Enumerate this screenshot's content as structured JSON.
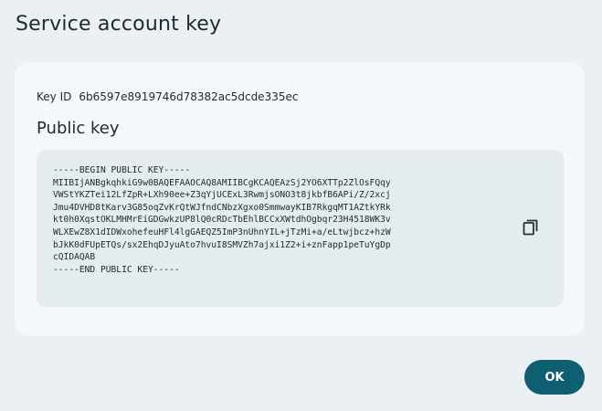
{
  "dialog": {
    "title": "Service account key",
    "ok_label": "OK"
  },
  "key": {
    "id_label": "Key ID",
    "id_value": "6b6597e8919746d78382ac5dcde335ec",
    "section_title": "Public key",
    "public_key_text": "-----BEGIN PUBLIC KEY-----\nMIIBIjANBgkqhkiG9w0BAQEFAAOCAQ8AMIIBCgKCAQEAzSj2YO6XTTp2ZlOsFQqy\nVWStYKZTei12LfZpR+LXh90ee+Z3qYjUCExL3RwmjsONO3t8jkbfB6APi/Z/2xcj\nJmu4DVHD8tKarv3G85oqZvKrQtWJfndCNbzXgxo0SmmwayKIB7RkgqMT1AZtkYRk\nkt0h0XqstOKLMHMrEiGDGwkzUP8lQ0cRDcTbEhlBCCxXWtdhOgbqr23H4518WK3v\nWLXEwZ8X1dIDWxohefeuHFl4lgGAEQZ5ImP3nUhnYIL+jTzMi+a/eLtwjbcz+hzW\nbJkK0dFUpETQs/sx2EhqDJyuAto7hvuI8SMVZh7ajxi1Z2+i+znFapp1peTuYgDp\ncQIDAQAB\n-----END PUBLIC KEY-----"
  },
  "icons": {
    "copy": "copy-icon"
  },
  "colors": {
    "background": "#eaf0f3",
    "card": "#f4f8fa",
    "key_box": "#e4ecef",
    "primary": "#0f5f73"
  }
}
